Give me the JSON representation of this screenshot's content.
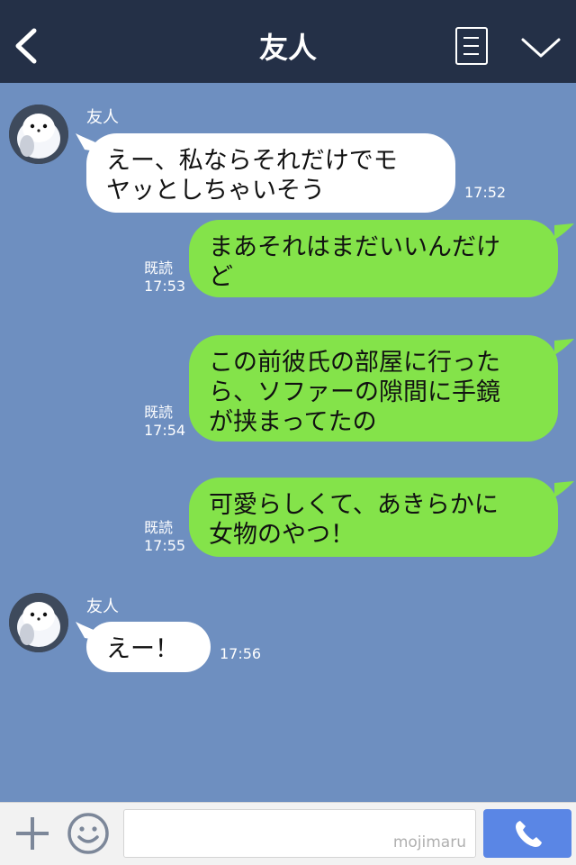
{
  "header": {
    "title": "友人"
  },
  "messages": [
    {
      "sender": "友人",
      "lines": [
        "えー、私ならそれだけでモ",
        "ヤッとしちゃいそう"
      ],
      "time": "17:52"
    },
    {
      "lines": [
        "まあそれはまだいいんだけ",
        "ど"
      ],
      "read": "既読",
      "time": "17:53"
    },
    {
      "lines": [
        "この前彼氏の部屋に行った",
        "ら、ソファーの隙間に手鏡",
        "が挟まってたの"
      ],
      "read": "既読",
      "time": "17:54"
    },
    {
      "lines": [
        "可愛らしくて、あきらかに",
        "女物のやつ！"
      ],
      "read": "既読",
      "time": "17:55"
    },
    {
      "sender": "友人",
      "lines": [
        "えー！"
      ],
      "time": "17:56"
    }
  ],
  "footer": {
    "input_watermark": "mojimaru"
  },
  "colors": {
    "header": "#243047",
    "chat_background": "#6e8fc0",
    "sent_bubble": "#84e34a",
    "received_bubble": "#ffffff",
    "call_button": "#5a86e5"
  },
  "icons": [
    "back-arrow-icon",
    "menu-icon",
    "chevron-down-icon",
    "plus-icon",
    "smiley-icon",
    "phone-icon"
  ]
}
